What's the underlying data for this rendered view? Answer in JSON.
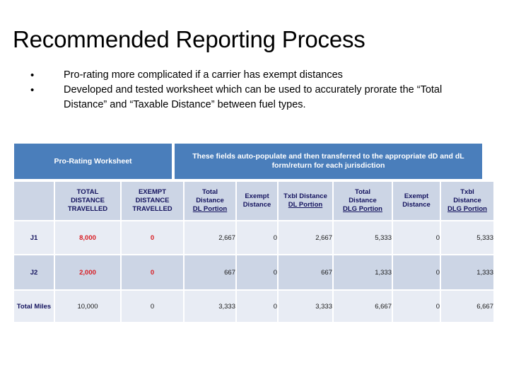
{
  "slide": {
    "title": "Recommended Reporting Process"
  },
  "bullets": [
    {
      "mark": "•",
      "text": "Pro-rating more complicated if a carrier has exempt distances"
    },
    {
      "mark": "•",
      "text": "Developed and tested worksheet which can be used to accurately prorate the “Total Distance” and “Taxable Distance” between fuel types."
    }
  ],
  "bands": {
    "left_label": "Pro-Rating Worksheet",
    "right_label": "These fields auto-populate and then transferred to the appropriate dD and dL form/return for each jurisdiction",
    "band_color": "#4a7ebb"
  },
  "table": {
    "headers": [
      {
        "lines": [
          ""
        ],
        "underline": ""
      },
      {
        "lines": [
          "TOTAL",
          "DISTANCE",
          "TRAVELLED"
        ],
        "underline": ""
      },
      {
        "lines": [
          "EXEMPT",
          "DISTANCE",
          "TRAVELLED"
        ],
        "underline": ""
      },
      {
        "lines": [
          "Total",
          "Distance"
        ],
        "underline": "DL Portion"
      },
      {
        "lines": [
          "Exempt",
          "Distance"
        ],
        "underline": ""
      },
      {
        "lines": [
          "Txbl Distance"
        ],
        "underline": "DL Portion"
      },
      {
        "lines": [
          "Total",
          "Distance"
        ],
        "underline": "DLG Portion"
      },
      {
        "lines": [
          "Exempt",
          "Distance"
        ],
        "underline": ""
      },
      {
        "lines": [
          "Txbl",
          "Distance"
        ],
        "underline": "DLG Portion"
      }
    ],
    "rows": [
      {
        "label": "J1",
        "total_distance_travelled": "8,000",
        "exempt_distance_travelled": "0",
        "total_distance_dl": "2,667",
        "exempt_distance_dl": "0",
        "txbl_distance_dl": "2,667",
        "total_distance_dlg": "5,333",
        "exempt_distance_dlg": "0",
        "txbl_distance_dlg": "5,333"
      },
      {
        "label": "J2",
        "total_distance_travelled": "2,000",
        "exempt_distance_travelled": "0",
        "total_distance_dl": "667",
        "exempt_distance_dl": "0",
        "txbl_distance_dl": "667",
        "total_distance_dlg": "1,333",
        "exempt_distance_dlg": "0",
        "txbl_distance_dlg": "1,333"
      },
      {
        "label": "Total Miles",
        "total_distance_travelled": "10,000",
        "exempt_distance_travelled": "0",
        "total_distance_dl": "3,333",
        "exempt_distance_dl": "0",
        "txbl_distance_dl": "3,333",
        "total_distance_dlg": "6,667",
        "exempt_distance_dlg": "0",
        "txbl_distance_dlg": "6,667"
      }
    ],
    "colors": {
      "header_bg": "#ccd5e5",
      "row_light": "#e8ecf4",
      "row_dark": "#ccd5e5",
      "header_text": "#14135e",
      "input_text": "#d81d23",
      "value_text": "#1a1a1a"
    }
  }
}
